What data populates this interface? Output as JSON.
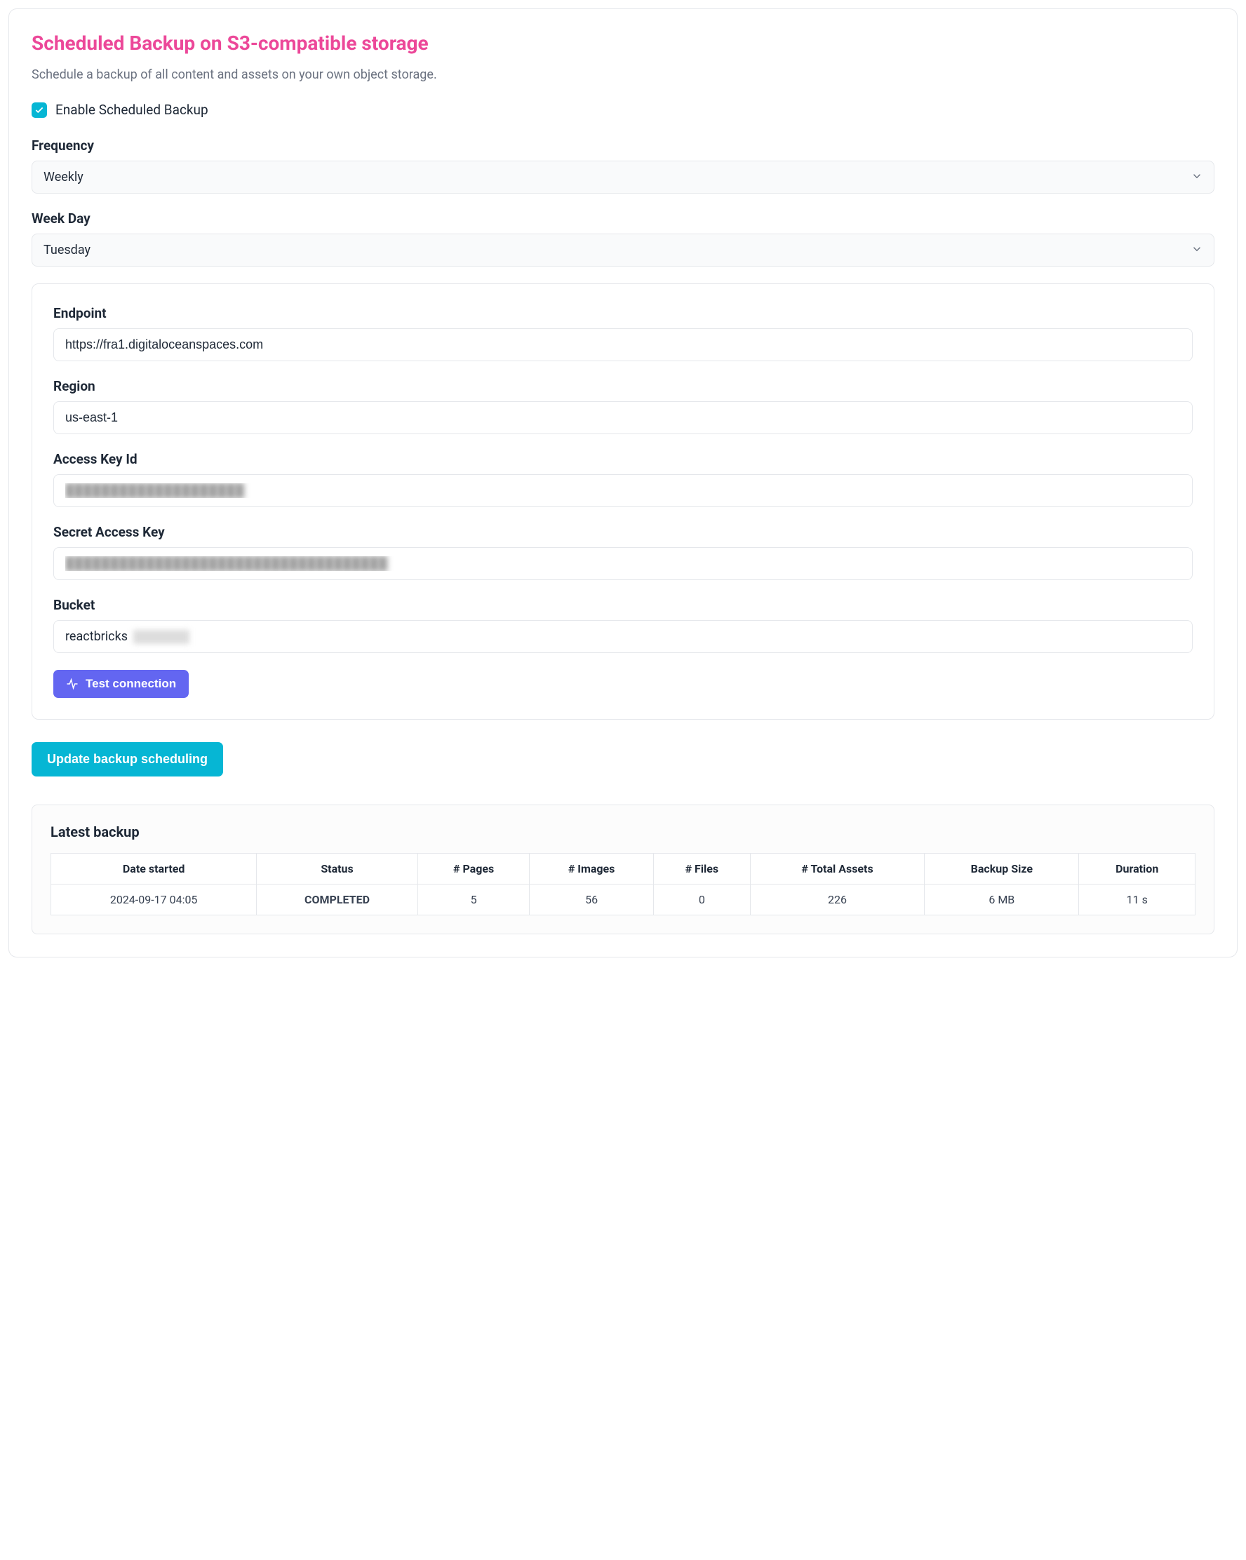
{
  "header": {
    "title": "Scheduled Backup on S3-compatible storage",
    "subtitle": "Schedule a backup of all content and assets on your own object storage."
  },
  "enable": {
    "label": "Enable Scheduled Backup",
    "checked": true
  },
  "frequency": {
    "label": "Frequency",
    "value": "Weekly"
  },
  "weekday": {
    "label": "Week Day",
    "value": "Tuesday"
  },
  "config": {
    "endpoint": {
      "label": "Endpoint",
      "value": "https://fra1.digitaloceanspaces.com"
    },
    "region": {
      "label": "Region",
      "value": "us-east-1"
    },
    "access_key": {
      "label": "Access Key Id",
      "value": "████████████████████"
    },
    "secret_key": {
      "label": "Secret Access Key",
      "value": "████████████████████████████████████"
    },
    "bucket": {
      "label": "Bucket",
      "value": "reactbricks"
    },
    "test_button": "Test connection"
  },
  "update_button": "Update backup scheduling",
  "backup": {
    "title": "Latest backup",
    "headers": {
      "date": "Date started",
      "status": "Status",
      "pages": "# Pages",
      "images": "# Images",
      "files": "# Files",
      "total": "# Total Assets",
      "size": "Backup Size",
      "duration": "Duration"
    },
    "row": {
      "date": "2024-09-17 04:05",
      "status": "COMPLETED",
      "pages": "5",
      "images": "56",
      "files": "0",
      "total": "226",
      "size": "6 MB",
      "duration": "11 s"
    }
  }
}
